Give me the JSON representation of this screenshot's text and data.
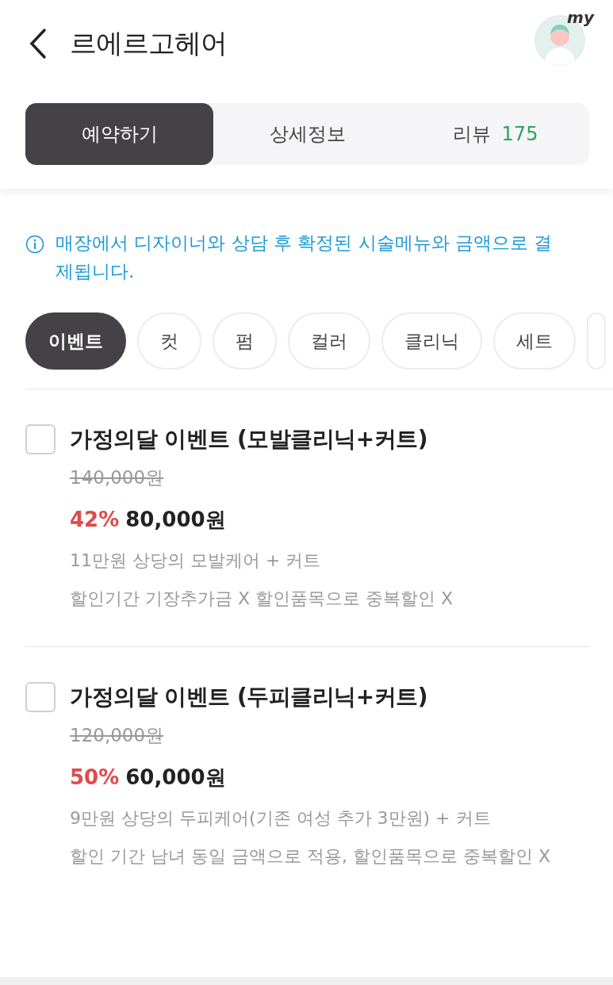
{
  "header": {
    "title": "르에르고헤어",
    "avatar_badge": "my"
  },
  "tabs": [
    {
      "label": "예약하기",
      "selected": true
    },
    {
      "label": "상세정보",
      "selected": false
    },
    {
      "label": "리뷰",
      "count": "175",
      "selected": false
    }
  ],
  "notice": "매장에서 디자이너와 상담 후 확정된 시술메뉴와 금액으로 결제됩니다.",
  "categories": [
    {
      "label": "이벤트",
      "selected": true
    },
    {
      "label": "컷",
      "selected": false
    },
    {
      "label": "펌",
      "selected": false
    },
    {
      "label": "컬러",
      "selected": false
    },
    {
      "label": "클리닉",
      "selected": false
    },
    {
      "label": "세트",
      "selected": false
    }
  ],
  "menu_items": [
    {
      "title": "가정의달 이벤트 (모발클리닉+커트)",
      "checked": false,
      "original_price": "140,000원",
      "discount": "42%",
      "price": "80,000원",
      "details": [
        "11만원 상당의 모발케어 + 커트",
        "할인기간 기장추가금 X 할인품목으로 중복할인 X"
      ]
    },
    {
      "title": "가정의달 이벤트 (두피클리닉+커트)",
      "checked": false,
      "original_price": "120,000원",
      "discount": "50%",
      "price": "60,000원",
      "details": [
        "9만원 상당의 두피케어(기존 여성 추가 3만원) + 커트",
        "할인 기간 남녀 동일 금액으로 적용, 할인품목으로 중복할인 X"
      ]
    }
  ]
}
